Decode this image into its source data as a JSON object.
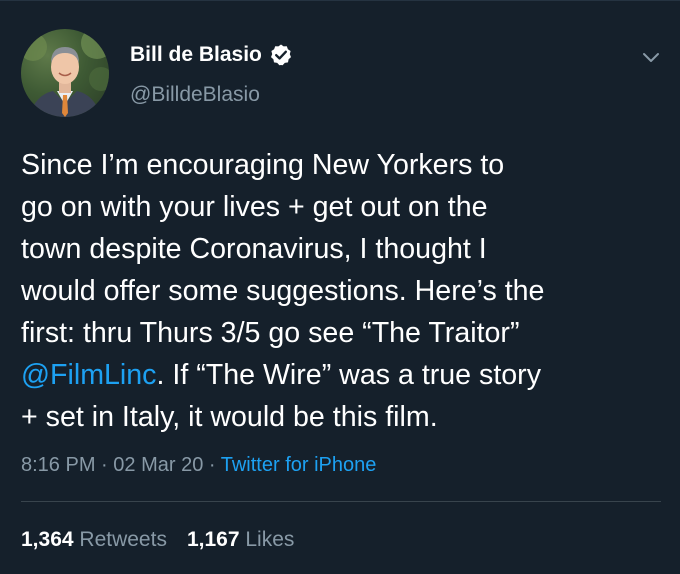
{
  "tweet": {
    "author": {
      "display_name": "Bill de Blasio",
      "handle": "@BilldeBlasio",
      "verified": true,
      "avatar_icon": "user-avatar"
    },
    "text_lines": [
      {
        "text": "Since I’m encouraging New Yorkers to"
      },
      {
        "text": "go on with your lives + get out on the"
      },
      {
        "text": "town despite Coronavirus, I thought I"
      },
      {
        "text": "would offer some suggestions. Here’s the"
      },
      {
        "text": "first: thru Thurs 3/5 go see “The Traitor”"
      },
      {
        "mention": "@FilmLinc",
        "rest": ". If “The Wire” was a true story"
      },
      {
        "text": "+ set in Italy, it would be this film."
      }
    ],
    "time": "8:16 PM",
    "separator": " · ",
    "date": "02 Mar 20",
    "source": "Twitter for iPhone",
    "retweets_count": "1,364",
    "retweets_label": "Retweets",
    "likes_count": "1,167",
    "likes_label": "Likes"
  },
  "colors": {
    "background": "#15202b",
    "primary_text": "#ffffff",
    "secondary_text": "#8899a6",
    "link": "#1da1f2",
    "divider": "#38444d"
  },
  "icons": {
    "verified": "verified-badge-icon",
    "menu": "chevron-down-icon"
  }
}
